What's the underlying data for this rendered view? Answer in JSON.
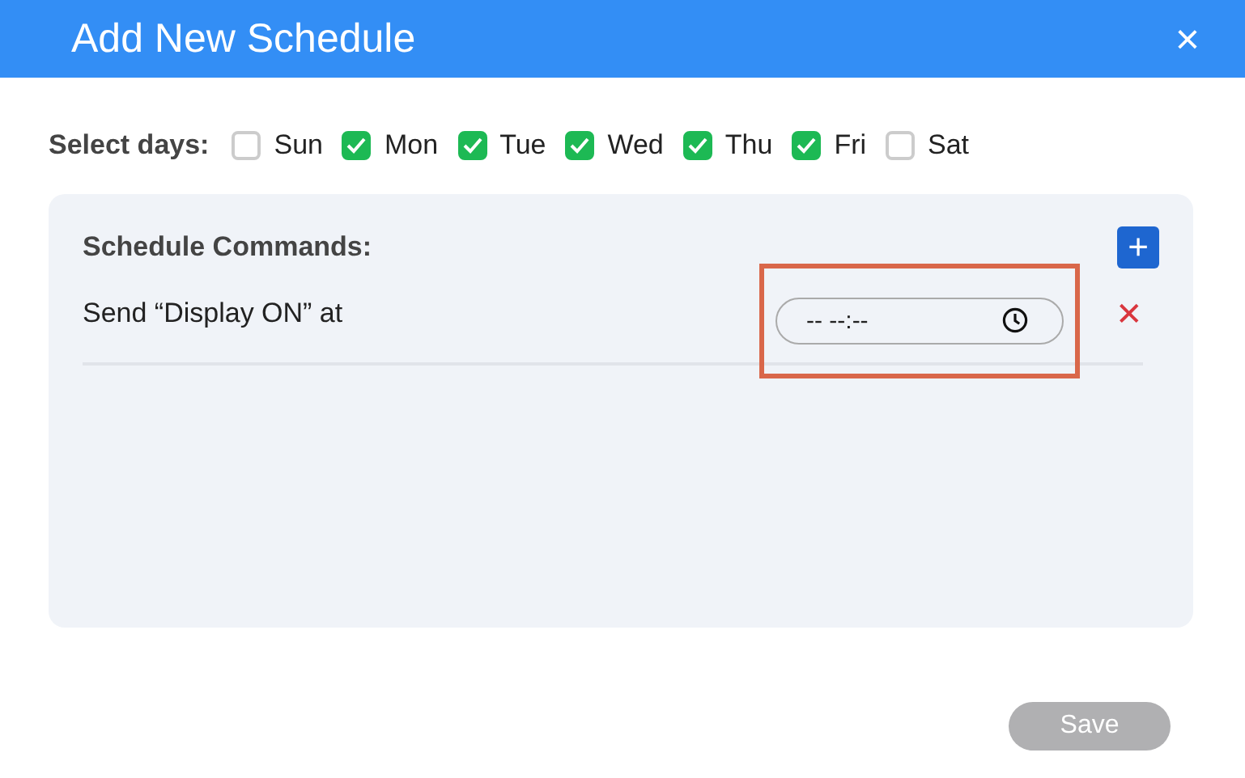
{
  "window": {
    "title": "Add New Schedule",
    "close": "×"
  },
  "days": {
    "label": "Select days:",
    "items": [
      {
        "label": "Sun",
        "checked": false
      },
      {
        "label": "Mon",
        "checked": true
      },
      {
        "label": "Tue",
        "checked": true
      },
      {
        "label": "Wed",
        "checked": true
      },
      {
        "label": "Thu",
        "checked": true
      },
      {
        "label": "Fri",
        "checked": true
      },
      {
        "label": "Sat",
        "checked": false
      }
    ]
  },
  "commands": {
    "title": "Schedule Commands:",
    "add": "+",
    "rows": [
      {
        "label": "Send “Display ON” at",
        "placeholder": "-- --:--",
        "highlighted": true,
        "remove": "✕"
      }
    ]
  },
  "save": {
    "label": "Save",
    "disabled": true
  }
}
